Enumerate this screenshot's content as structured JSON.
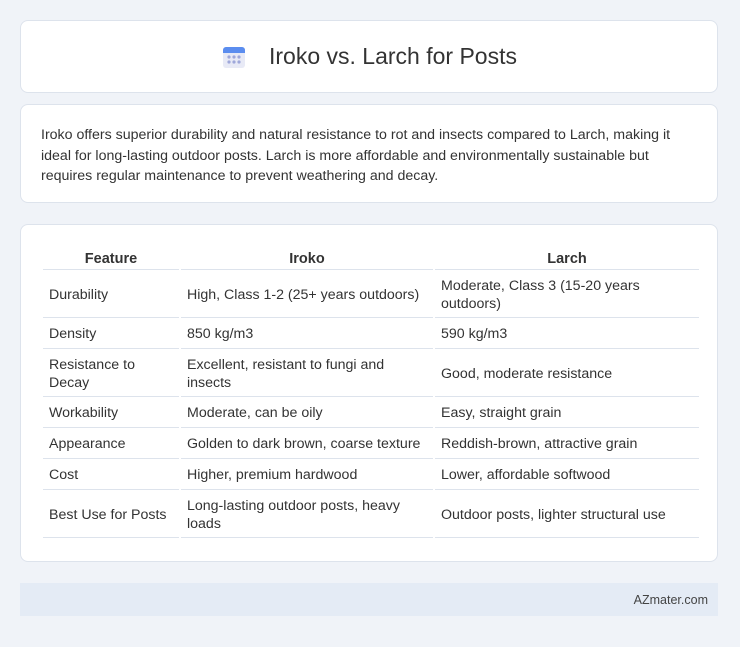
{
  "header": {
    "icon": "calendar-icon",
    "title": "Iroko vs. Larch for Posts"
  },
  "summary": {
    "text": "Iroko offers superior durability and natural resistance to rot and insects compared to Larch, making it ideal for long-lasting outdoor posts. Larch is more affordable and environmentally sustainable but requires regular maintenance to prevent weathering and decay."
  },
  "table": {
    "headers": [
      "Feature",
      "Iroko",
      "Larch"
    ],
    "rows": [
      [
        "Durability",
        "High, Class 1-2 (25+ years outdoors)",
        "Moderate, Class 3 (15-20 years outdoors)"
      ],
      [
        "Density",
        "850 kg/m3",
        "590 kg/m3"
      ],
      [
        "Resistance to Decay",
        "Excellent, resistant to fungi and insects",
        "Good, moderate resistance"
      ],
      [
        "Workability",
        "Moderate, can be oily",
        "Easy, straight grain"
      ],
      [
        "Appearance",
        "Golden to dark brown, coarse texture",
        "Reddish-brown, attractive grain"
      ],
      [
        "Cost",
        "Higher, premium hardwood",
        "Lower, affordable softwood"
      ],
      [
        "Best Use for Posts",
        "Long-lasting outdoor posts, heavy loads",
        "Outdoor posts, lighter structural use"
      ]
    ]
  },
  "footer": {
    "brand": "AZmater.com"
  }
}
